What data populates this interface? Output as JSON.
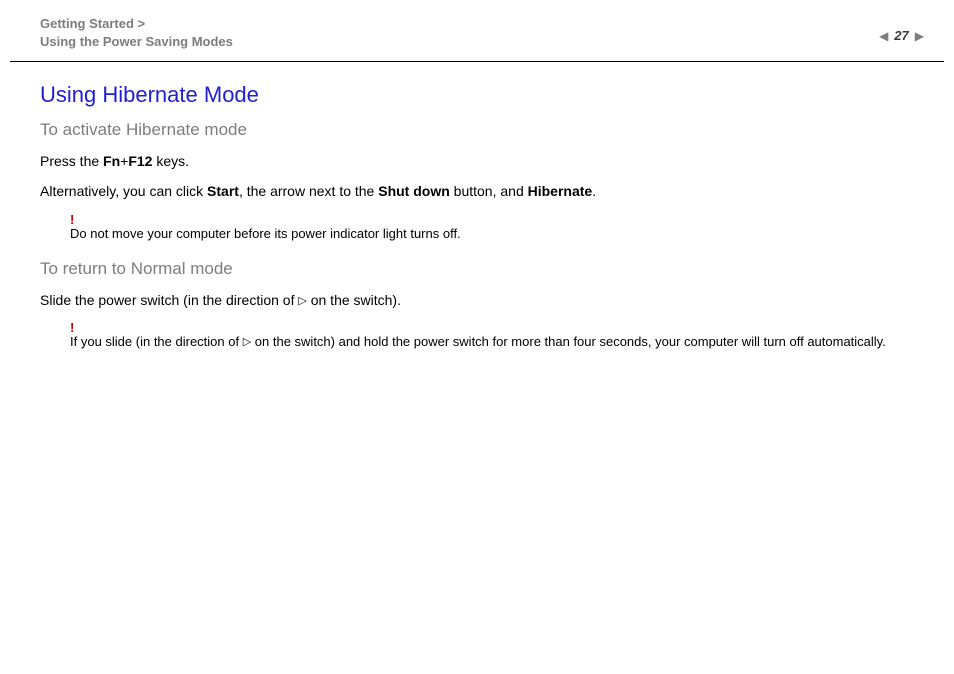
{
  "breadcrumb": {
    "line1": "Getting Started >",
    "line2": "Using the Power Saving Modes"
  },
  "page_number": "27",
  "nav": {
    "prev_glyph": "◀",
    "next_glyph": "▶"
  },
  "title": "Using Hibernate Mode",
  "section1": {
    "heading": "To activate Hibernate mode",
    "p1_pre": "Press the ",
    "p1_b1": "Fn",
    "p1_mid": "+",
    "p1_b2": "F12",
    "p1_post": " keys.",
    "p2_pre": "Alternatively, you can click ",
    "p2_b1": "Start",
    "p2_mid1": ", the arrow next to the ",
    "p2_b2": "Shut down",
    "p2_mid2": " button, and ",
    "p2_b3": "Hibernate",
    "p2_post": ".",
    "note_bang": "!",
    "note_text": "Do not move your computer before its power indicator light turns off."
  },
  "section2": {
    "heading": "To return to Normal mode",
    "p1_pre": "Slide the power switch (in the direction of ",
    "p1_tri": "▷",
    "p1_post": " on the switch).",
    "note_bang": "!",
    "note_pre": "If you slide (in the direction of ",
    "note_tri": "▷",
    "note_post": " on the switch) and hold the power switch for more than four seconds, your computer will turn off automatically."
  }
}
